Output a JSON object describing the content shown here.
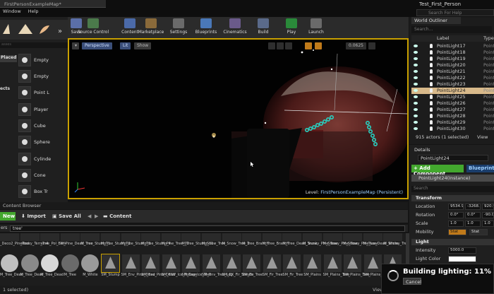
{
  "window": {
    "tab": "FirstPersonExampleMap*",
    "project": "Test_First_Person",
    "help_search": "Search For Help"
  },
  "menu": [
    "Window",
    "Help"
  ],
  "toolbar": [
    {
      "label": "Save",
      "icon": "save-icon"
    },
    {
      "label": "Source Control",
      "icon": "source-control-icon"
    },
    {
      "label": "Content",
      "icon": "content-icon"
    },
    {
      "label": "Marketplace",
      "icon": "marketplace-icon"
    },
    {
      "label": "Settings",
      "icon": "gear-icon"
    },
    {
      "label": "Blueprints",
      "icon": "blueprint-icon"
    },
    {
      "label": "Cinematics",
      "icon": "cinematics-icon"
    },
    {
      "label": "Build",
      "icon": "build-icon"
    },
    {
      "label": "Play",
      "icon": "play-icon"
    },
    {
      "label": "Launch",
      "icon": "launch-icon"
    }
  ],
  "place": {
    "search_placeholder": "asses",
    "categories": [
      "Placed",
      "ects"
    ],
    "items": [
      "Empty",
      "Empty",
      "Point L",
      "Player",
      "Cube",
      "Sphere",
      "Cylinde",
      "Cone",
      "Box Tr"
    ]
  },
  "viewport": {
    "perspective": "Perspective",
    "lit": "Lit",
    "show": "Show",
    "snap_value": "0.0625",
    "level_prefix": "Level:",
    "level_name": "FirstPersonExampleMap (Persistent)"
  },
  "outliner": {
    "tab": "World Outliner",
    "search_placeholder": "Search...",
    "col_label": "Label",
    "col_type": "Type",
    "rows": [
      {
        "name": "PointLight17",
        "type": "Point"
      },
      {
        "name": "PointLight18",
        "type": "Point"
      },
      {
        "name": "PointLight19",
        "type": "Point"
      },
      {
        "name": "PointLight20",
        "type": "Point"
      },
      {
        "name": "PointLight21",
        "type": "Point"
      },
      {
        "name": "PointLight22",
        "type": "Point"
      },
      {
        "name": "PointLight23",
        "type": "Point"
      },
      {
        "name": "PointLight24",
        "type": "Point",
        "selected": true
      },
      {
        "name": "PointLight25",
        "type": "Point"
      },
      {
        "name": "PointLight26",
        "type": "Point"
      },
      {
        "name": "PointLight27",
        "type": "Point"
      },
      {
        "name": "PointLight28",
        "type": "Point"
      },
      {
        "name": "PointLight29",
        "type": "Point"
      },
      {
        "name": "PointLight30",
        "type": "Point"
      }
    ],
    "count": "915 actors (1 selected)",
    "view": "View"
  },
  "details": {
    "tab": "Details",
    "name": "PointLight24",
    "add_component": "+ Add Component",
    "blueprint": "Blueprint",
    "instance": "PointLight24(Instance)",
    "search_placeholder": "Search",
    "transform_title": "Transform",
    "location_label": "Location",
    "location": [
      "9534.97",
      "-3268.0",
      "920.99"
    ],
    "rotation_label": "Rotation",
    "rotation": [
      "0.0°",
      "0.0°",
      "-90.0"
    ],
    "scale_label": "Scale",
    "scale": [
      "1.0",
      "1.0",
      "1.0"
    ],
    "mobility_label": "Mobility",
    "mobility": [
      "Stat",
      "Stat"
    ],
    "light_title": "Light",
    "intensity_label": "Intensity",
    "intensity": "5000.0",
    "light_color_label": "Light Color"
  },
  "content_browser": {
    "header": "Content Browser",
    "new": "New",
    "import": "Import",
    "save_all": "Save All",
    "path": "Content",
    "filter_prefix": "ers",
    "search_value": "tree'",
    "row1": [
      "_Deco2_PineTree",
      "_Rocky_Terrain4",
      "_Tree_Pol_Bark",
      "M_Pine_Dead_Tree",
      "M_Tree_Stump_1",
      "M_Tree_Stump_2",
      "M_Tree_Stump_3",
      "M_Tree_Stump_4",
      "M_Pine_Tree_02",
      "M_Tree_Stump_01",
      "M_Snow_Tree",
      "M_Snow_Tree_2",
      "M_Tree_Branch",
      "M_Tree_Branch",
      "M_Tree_Dead_Trunk",
      "M_Snowy_Pine_Tree",
      "M_Snowy_Pine_Tree",
      "M_Snowy_Pine_Low",
      "M_Tree_Dead_White",
      "M_Snowy_Tree"
    ],
    "row2": [
      "M_Tree_Dead",
      "M_Tree_Dead",
      "M_Tree_Dead",
      "M_Tree",
      "M_White",
      "SM_Stump",
      "SM_Env_Pine_Dead",
      "SM_Env_Pine_Dead",
      "SM_ENV_Ice_Foliage",
      "SM_Env_Ice_Tree",
      "SM_Env_Tree_Log",
      "SM_EX_Fir_Shrubs",
      "SM_Fir_Tree",
      "SM_Fir_Tree",
      "SM_Fir_Tree",
      "SM_Plains",
      "SM_Plains_Tree",
      "SM_Plains_Tree",
      "SM_Plains_Tree",
      "SM_Plains"
    ],
    "selection": "1 selected)",
    "view_options": "View Options"
  },
  "toast": {
    "message": "Building lighting:  11%",
    "cancel": "Cancel"
  },
  "colors": {
    "accent_yellow": "#c9a000",
    "add_component_green": "#43a82e",
    "selected_row": "#d8b98a",
    "cyan_lights": "#28d0c0"
  }
}
